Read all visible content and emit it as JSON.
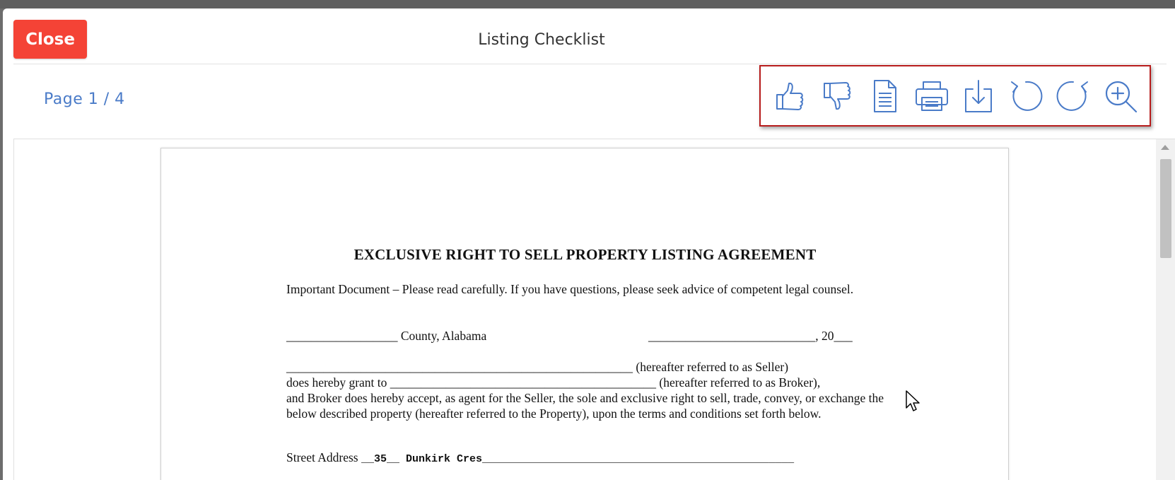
{
  "modal": {
    "close_label": "Close",
    "title": "Listing Checklist"
  },
  "viewer": {
    "page_indicator": "Page 1 / 4",
    "toolbar_icons": [
      "thumbs-up-icon",
      "thumbs-down-icon",
      "document-icon",
      "print-icon",
      "download-icon",
      "rotate-left-icon",
      "rotate-right-icon",
      "zoom-in-icon"
    ],
    "accent_color": "#4a7bc8",
    "close_color": "#f44336",
    "highlight_color": "#b71c1c"
  },
  "document": {
    "heading": "EXCLUSIVE RIGHT TO SELL PROPERTY LISTING AGREEMENT",
    "important_notice": "Important Document – Please read carefully.  If you have questions, please seek advice of competent legal counsel.",
    "county_line": "__________________ County, Alabama",
    "date_line": "___________________________, 20___",
    "grant_line_1": "________________________________________________________ (hereafter referred to as Seller)",
    "grant_line_2": "does hereby grant to ___________________________________________ (hereafter referred to as Broker),",
    "grant_rest": "and Broker does hereby accept, as agent for the Seller, the sole and exclusive right to sell, trade, convey, or exchange the below described property (hereafter referred to the Property), upon the terms and conditions set forth below.",
    "street_label": "Street Address",
    "street_value": "__35__ Dunkirk Cres_________________________________________________"
  }
}
